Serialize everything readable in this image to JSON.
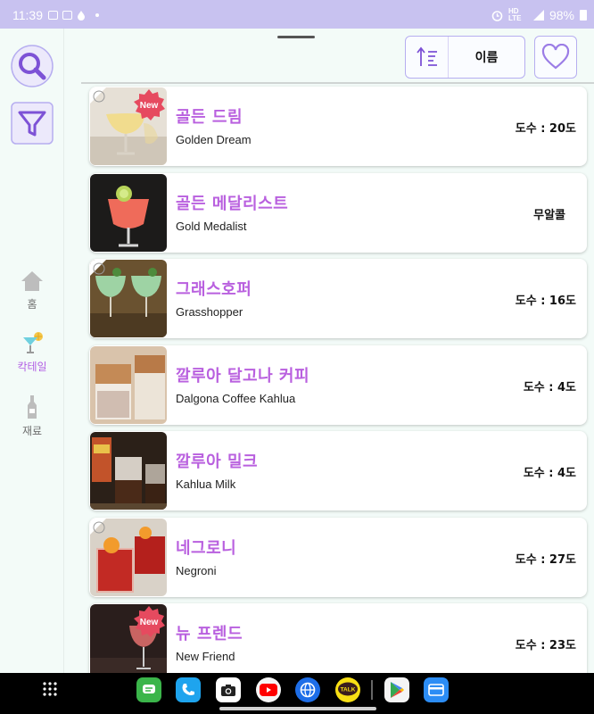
{
  "status": {
    "time": "11:39",
    "network": "HD LTE",
    "battery": "98%"
  },
  "rail": {
    "search_icon": "search-icon",
    "filter_icon": "filter-icon",
    "nav": [
      {
        "label": "홈",
        "icon": "home-icon"
      },
      {
        "label": "칵테일",
        "icon": "cocktail-icon"
      },
      {
        "label": "재료",
        "icon": "bottle-icon"
      }
    ]
  },
  "toolbar": {
    "sort_label": "이름",
    "sort_icon": "sort-ascending-icon",
    "favorite_icon": "heart-icon"
  },
  "cocktails": [
    {
      "name_ko": "골든 드림",
      "name_en": "Golden Dream",
      "abv": "도수 : 20도",
      "is_new": true
    },
    {
      "name_ko": "골든 메달리스트",
      "name_en": "Gold Medalist",
      "abv": "무알콜",
      "is_new": false
    },
    {
      "name_ko": "그래스호퍼",
      "name_en": "Grasshopper",
      "abv": "도수 : 16도",
      "is_new": false
    },
    {
      "name_ko": "깔루아 달고나 커피",
      "name_en": "Dalgona Coffee Kahlua",
      "abv": "도수 : 4도",
      "is_new": false
    },
    {
      "name_ko": "깔루아 밀크",
      "name_en": "Kahlua Milk",
      "abv": "도수 : 4도",
      "is_new": false
    },
    {
      "name_ko": "네그로니",
      "name_en": "Negroni",
      "abv": "도수 : 27도",
      "is_new": false
    },
    {
      "name_ko": "뉴 프렌드",
      "name_en": "New Friend",
      "abv": "도수 : 23도",
      "is_new": true
    }
  ],
  "new_badge": "New",
  "taskbar": {
    "apps": [
      "messages-icon",
      "phone-icon",
      "camera-icon",
      "youtube-icon",
      "browser-icon",
      "kakaotalk-icon",
      "play-store-icon",
      "wallet-icon"
    ],
    "kakao_text": "TALK"
  },
  "colors": {
    "accent": "#b960df",
    "status_bar": "#c8c2f0",
    "border": "#b6aef0"
  }
}
